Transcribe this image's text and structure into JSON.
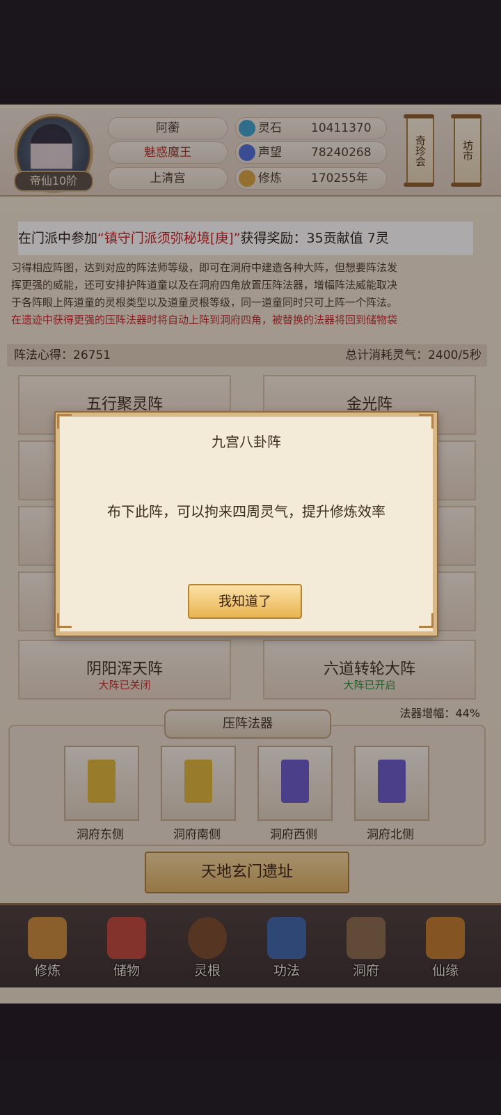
{
  "player": {
    "name": "阿蘅",
    "title": "魅惑魔王",
    "sect": "上清宫",
    "rank": "帝仙10阶"
  },
  "stats": [
    {
      "label": "灵石",
      "value": "10411370",
      "icon": "spirit-stone-icon",
      "color": "#3fa0c9"
    },
    {
      "label": "声望",
      "value": "78240268",
      "icon": "prestige-icon",
      "color": "#4f6fd6"
    },
    {
      "label": "修炼",
      "value": "170255年",
      "icon": "meditation-icon",
      "color": "#d8a340"
    }
  ],
  "side_buttons": {
    "treasure_fair": "奇珍会",
    "market": "坊市"
  },
  "notice": {
    "prefix": "在门派中参加",
    "event": "“镇守门派须弥秘境[庚]”",
    "suffix": "获得奖励：35贡献值 7灵"
  },
  "description": {
    "line1": "习得相应阵图，达到对应的阵法师等级，即可在洞府中建造各种大阵，但想要阵法发",
    "line2": "挥更强的威能，还可安排护阵道童以及在洞府四角放置压阵法器，增幅阵法威能取决",
    "line3": "于各阵眼上阵道童的灵根类型以及道童灵根等级，同一道童同时只可上阵一个阵法。",
    "line4": "在遗迹中获得更强的压阵法器时将自动上阵到洞府四角，被替换的法器将回到储物袋"
  },
  "stat_bar": {
    "insight_label": "阵法心得：26751",
    "consume_label": "总计消耗灵气：2400/5秒"
  },
  "arrays": [
    {
      "name": "五行聚灵阵",
      "status": ""
    },
    {
      "name": "金光阵",
      "status": ""
    },
    {
      "name": "阴阳浑天阵",
      "status": "大阵已关闭"
    },
    {
      "name": "六道转轮大阵",
      "status": "大阵已开启"
    }
  ],
  "status_colors": {
    "closed": "#c2312b",
    "open": "#2f8a3a"
  },
  "artifact_section": {
    "title": "压阵法器",
    "boost": "法器增幅：44%",
    "slots": [
      {
        "label": "洞府东侧",
        "flag_color": "#e0b53a"
      },
      {
        "label": "洞府南侧",
        "flag_color": "#e0b53a"
      },
      {
        "label": "洞府西侧",
        "flag_color": "#6b5ac8"
      },
      {
        "label": "洞府北侧",
        "flag_color": "#6b5ac8"
      }
    ]
  },
  "ruin_button": "天地玄门遗址",
  "nav": [
    {
      "label": "修炼",
      "icon": "meditation-icon",
      "color": "#c98a3a"
    },
    {
      "label": "储物",
      "icon": "storage-bag-icon",
      "color": "#c0463a"
    },
    {
      "label": "灵根",
      "icon": "spirit-root-icon",
      "color": "#7a4a2a"
    },
    {
      "label": "功法",
      "icon": "scripture-book-icon",
      "color": "#3d66a8"
    },
    {
      "label": "洞府",
      "icon": "cave-mansion-icon",
      "color": "#8a6a4a"
    },
    {
      "label": "仙缘",
      "icon": "gourd-icon",
      "color": "#c07a2a"
    }
  ],
  "dialog": {
    "title": "九宫八卦阵",
    "body": "布下此阵，可以拘来四周灵气，提升修炼效率",
    "confirm": "我知道了"
  }
}
